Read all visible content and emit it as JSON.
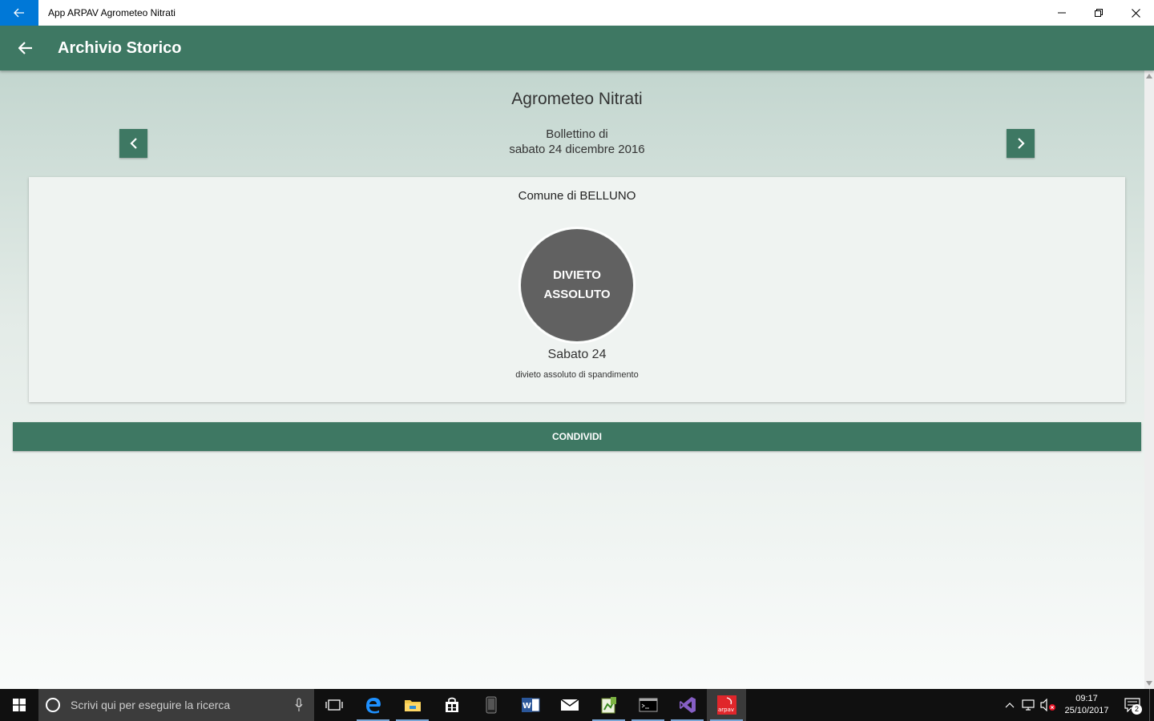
{
  "window": {
    "title": "App ARPAV Agrometeo Nitrati"
  },
  "appbar": {
    "title": "Archivio Storico"
  },
  "main": {
    "heading": "Agrometeo Nitrati",
    "bulletin_line1": "Bollettino di",
    "bulletin_line2": "sabato 24 dicembre 2016",
    "card": {
      "comune": "Comune di BELLUNO",
      "status_line1": "DIVIETO",
      "status_line2": "ASSOLUTO",
      "status_color": "#616161",
      "day": "Sabato 24",
      "description": "divieto assoluto di spandimento"
    },
    "share_label": "CONDIVIDI"
  },
  "colors": {
    "accent": "#3e7863",
    "windows_blue": "#0078d7"
  },
  "taskbar": {
    "search_placeholder": "Scrivi qui per eseguire la ricerca",
    "apps": [
      "edge-icon",
      "file-explorer-icon",
      "store-icon",
      "phone-icon",
      "word-icon",
      "mail-icon",
      "notepad-icon",
      "terminal-icon",
      "visual-studio-icon",
      "arpav-app-icon"
    ],
    "clock_time": "09:17",
    "clock_date": "25/10/2017",
    "notification_count": "2"
  }
}
